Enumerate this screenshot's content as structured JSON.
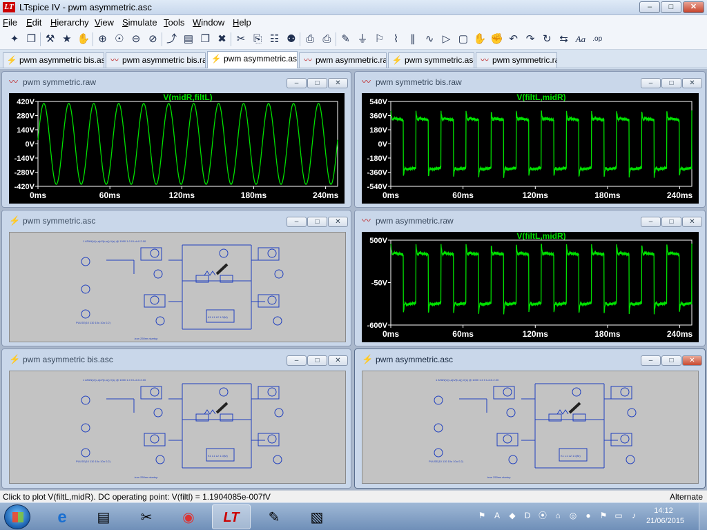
{
  "window": {
    "title": "LTspice IV - pwm asymmetric.asc",
    "logo_text": "LT",
    "min_glyph": "–",
    "max_glyph": "□",
    "close_glyph": "✕"
  },
  "menu": [
    {
      "key": "F",
      "rest": "ile"
    },
    {
      "key": "E",
      "rest": "dit"
    },
    {
      "key": "H",
      "rest": "ierarchy"
    },
    {
      "key": "V",
      "rest": "iew"
    },
    {
      "key": "S",
      "rest": "imulate"
    },
    {
      "key": "T",
      "rest": "ools"
    },
    {
      "key": "W",
      "rest": "indow"
    },
    {
      "key": "H",
      "rest": "elp"
    }
  ],
  "toolbar_icons": [
    "new-schematic-icon",
    "open-icon",
    "control-panel-icon",
    "run-icon",
    "halt-icon",
    "zoom-in-icon",
    "pan-icon",
    "zoom-out-icon",
    "zoom-cancel-icon",
    "autorange-icon",
    "tile-icon",
    "cascade-icon",
    "close-window-icon",
    "cut-icon",
    "copy-icon",
    "find-icon",
    "find-binoculars-icon",
    "print-setup-icon",
    "print-icon",
    "wire-icon",
    "ground-icon",
    "label-net-icon",
    "resistor-icon",
    "capacitor-icon",
    "inductor-icon",
    "diode-icon",
    "component-icon",
    "move-icon",
    "drag-icon",
    "undo-icon",
    "redo-icon",
    "rotate-icon",
    "mirror-icon",
    "text-icon",
    "spice-directive-icon"
  ],
  "toolbar_glyphs": [
    "✦",
    "❐",
    "⚒",
    "★",
    "✋",
    "⊕",
    "☉",
    "⊖",
    "⊘",
    "⤴",
    "▤",
    "❐",
    "✖",
    "✂",
    "⎘",
    "☷",
    "⚉",
    "⎙",
    "⎙",
    "✎",
    "⏚",
    "⚐",
    "⌇",
    "∥",
    "∿",
    "▷",
    "▢",
    "✋",
    "✊",
    "↶",
    "↷",
    "↻",
    "⇆",
    "Aa",
    ".op"
  ],
  "tabs": [
    {
      "label": "pwm asymmetric bis.asc",
      "kind": "schematic"
    },
    {
      "label": "pwm asymmetric bis.raw",
      "kind": "waveform"
    },
    {
      "label": "pwm asymmetric.asc",
      "kind": "schematic",
      "active": true
    },
    {
      "label": "pwm asymmetric.raw",
      "kind": "waveform"
    },
    {
      "label": "pwm symmetric.asc",
      "kind": "schematic"
    },
    {
      "label": "pwm symmetric.raw",
      "kind": "waveform"
    }
  ],
  "windows": {
    "w1": {
      "title": "pwm symmetric.raw",
      "kind": "waveform"
    },
    "w2": {
      "title": "pwm symmetric bis.raw",
      "kind": "waveform"
    },
    "w3": {
      "title": "pwm symmetric.asc",
      "kind": "schematic"
    },
    "w4": {
      "title": "pwm asymmetric.raw",
      "kind": "waveform"
    },
    "w5": {
      "title": "pwm asymmetric bis.asc",
      "kind": "schematic"
    },
    "w6": {
      "title": "pwm asymmetric.asc",
      "kind": "schematic",
      "active": true
    }
  },
  "win_buttons": {
    "min": "–",
    "max": "□",
    "close": "✕"
  },
  "chart_data": [
    {
      "type": "line",
      "window": "pwm symmetric.raw",
      "title": "V(midR,filtL)",
      "series": [
        {
          "name": "V(midR,filtL)",
          "shape": "sine",
          "amplitude": 400,
          "cycles": 12
        }
      ],
      "x_ticks": [
        "0ms",
        "60ms",
        "120ms",
        "180ms",
        "240ms"
      ],
      "x_range": [
        0,
        250
      ],
      "x_unit": "ms",
      "y_ticks": [
        "420V",
        "280V",
        "140V",
        "0V",
        "-140V",
        "-280V",
        "-420V"
      ],
      "ylim": [
        -420,
        420
      ],
      "trace_color": "#00e000",
      "background": "#000000"
    },
    {
      "type": "line",
      "window": "pwm symmetric bis.raw",
      "title": "V(filtL,midR)",
      "series": [
        {
          "name": "V(filtL,midR)",
          "shape": "square-overshoot",
          "amplitude": 330,
          "peak": 420,
          "cycles": 12
        }
      ],
      "x_ticks": [
        "0ms",
        "60ms",
        "120ms",
        "180ms",
        "240ms"
      ],
      "x_range": [
        0,
        250
      ],
      "x_unit": "ms",
      "y_ticks": [
        "540V",
        "360V",
        "180V",
        "0V",
        "-180V",
        "-360V",
        "-540V"
      ],
      "ylim": [
        -540,
        540
      ],
      "trace_color": "#00e000",
      "background": "#000000"
    },
    {
      "type": "line",
      "window": "pwm asymmetric.raw",
      "title": "V(filtL,midR)",
      "series": [
        {
          "name": "V(filtL,midR)",
          "shape": "square-overshoot",
          "amplitude": 340,
          "peak": 450,
          "cycles": 12
        }
      ],
      "x_ticks": [
        "0ms",
        "60ms",
        "120ms",
        "180ms",
        "240ms"
      ],
      "x_range": [
        0,
        250
      ],
      "x_unit": "ms",
      "y_ticks": [
        "500V",
        "-50V",
        "-600V"
      ],
      "ylim": [
        -600,
        500
      ],
      "trace_color": "#00e000",
      "background": "#000000"
    }
  ],
  "schematics": {
    "w3": {
      "spice_line": "1 ATAN(V(c,a)/V(b,a)) V(s) @ 1000 1.0 0 Ld=0.2.00",
      "sim_cmd": ".tran 250ms startup",
      "model": "K1 L1 L2 1.0(M)",
      "src": "PULSE(10 110 10u 10u 0.2)"
    },
    "w5": {
      "spice_line": "1 ATAN(V(c,a)/V(b,a)) V(s) @ 1000 1.0 0 Ld=0.2.00",
      "sim_cmd": ".tran 250ms startup",
      "model": "K1 L1 L2 1.0(M)",
      "src": "PULSE(10 110 10u 10u 0.2)"
    },
    "w6": {
      "spice_line": "1 ATAN(V(c,a)/V(b,a)) V(s) @ 1000 1.0 0 Ld=0.2.00",
      "sim_cmd": ".tran 250ms startup",
      "model": "K1 L1 L2 1.0(M)",
      "src": "PULSE(10 110 10u 10u 0.2)"
    }
  },
  "status": {
    "text": "Click to plot V(filtL,midR).  DC operating point: V(filtl) = 1.1904085e-007fV",
    "mode": "Alternate"
  },
  "taskbar": {
    "items": [
      "internet-explorer",
      "file-explorer",
      "snipping-tool",
      "chrome",
      "ltspice",
      "paint",
      "notepad"
    ],
    "glyphs": [
      "e",
      "▤",
      "✂",
      "◉",
      "LT",
      "✎",
      "▧"
    ],
    "active": "ltspice",
    "tray_icons": [
      "windows-flag-icon",
      "avast-icon",
      "battery-icon",
      "ime-icon",
      "network-icon",
      "antivirus-icon",
      "drive-icon",
      "sync-icon",
      "action-center-icon",
      "display-icon",
      "volume-icon"
    ],
    "tray_glyphs": [
      "⚑",
      "A",
      "◆",
      "D",
      "⦿",
      "⌂",
      "◎",
      "●",
      "⚑",
      "▭",
      "♪"
    ],
    "time": "14:12",
    "date": "21/06/2015"
  },
  "colors": {
    "trace": "#00e000",
    "plot_bg": "#000000",
    "axis_text": "#ffffff",
    "title_green": "#00e000",
    "wire": "#1f3fbf",
    "sch_bg": "#c3c3c3"
  }
}
